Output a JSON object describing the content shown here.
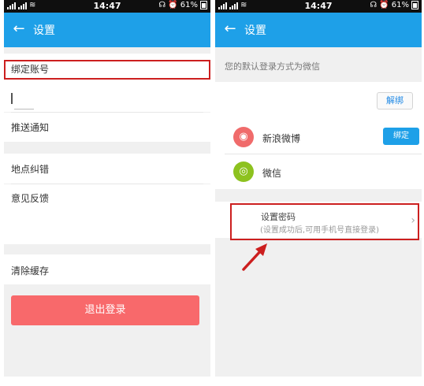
{
  "status_bar": {
    "time": "14:47",
    "battery": "61%"
  },
  "left_screen": {
    "header": {
      "title": "设置"
    },
    "items": {
      "bind_account": "绑定账号",
      "push_notifications": "推送通知",
      "location_correction": "地点纠错",
      "feedback": "意见反馈",
      "clear_cache": "清除缓存"
    },
    "logout_label": "退出登录"
  },
  "right_screen": {
    "header": {
      "title": "设置"
    },
    "default_login_text": "您的默认登录方式为微信",
    "unbind_label": "解绑",
    "accounts": [
      {
        "name": "新浪微博",
        "icon": "weibo-icon",
        "action_label": "绑定"
      },
      {
        "name": "微信",
        "icon": "wechat-icon"
      }
    ],
    "password": {
      "title": "设置密码",
      "subtitle": "(设置成功后,可用手机号直接登录)"
    }
  },
  "colors": {
    "app_bar": "#1ea0e8",
    "logout_button": "#f8696b",
    "highlight": "#cc1f1f",
    "weibo": "#f06b6b",
    "wechat": "#8dc21f"
  }
}
